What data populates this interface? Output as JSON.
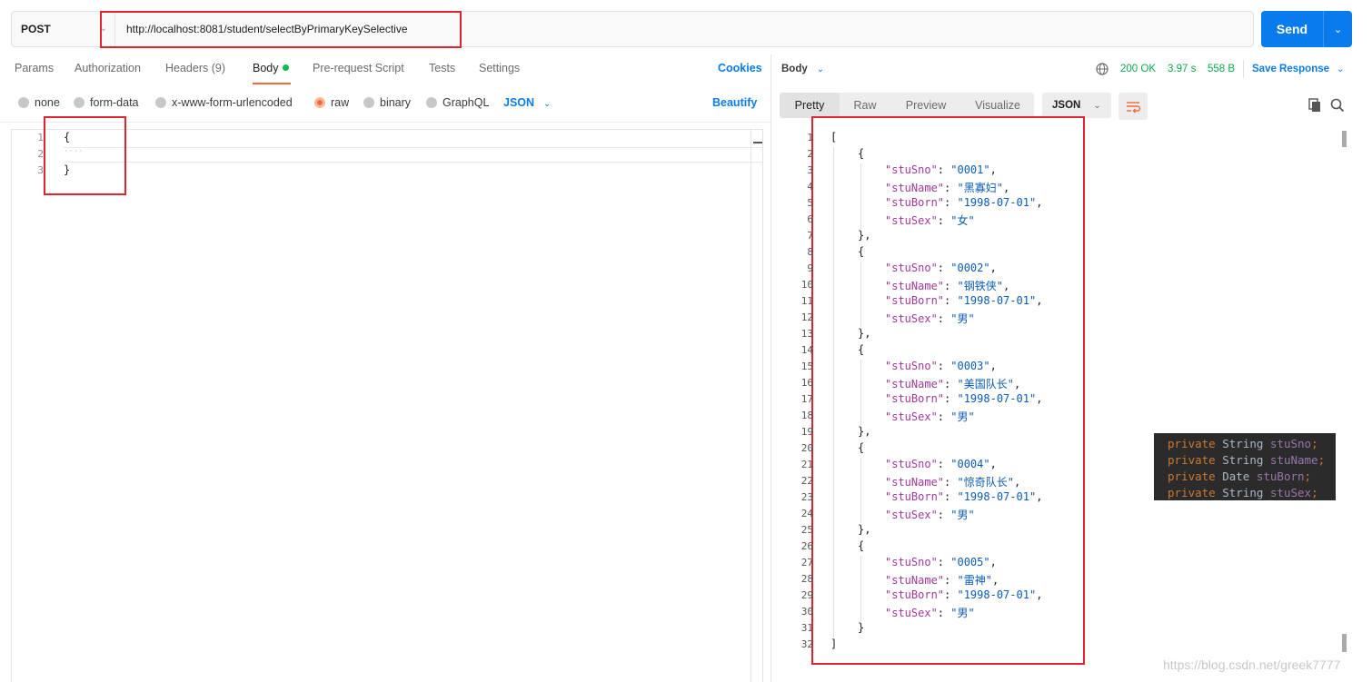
{
  "request": {
    "method": "POST",
    "url": "http://localhost:8081/student/selectByPrimaryKeySelective",
    "send_label": "Send"
  },
  "request_tabs": [
    "Params",
    "Authorization",
    "Headers (9)",
    "Body",
    "Pre-request Script",
    "Tests",
    "Settings"
  ],
  "cookies_label": "Cookies",
  "body_types": [
    "none",
    "form-data",
    "x-www-form-urlencoded",
    "raw",
    "binary",
    "GraphQL"
  ],
  "body_selected": "raw",
  "body_format": "JSON",
  "beautify_label": "Beautify",
  "request_editor": {
    "line_numbers": [
      "1",
      "2",
      "3"
    ],
    "lines": [
      "{",
      "····",
      "}"
    ]
  },
  "response": {
    "label": "Body",
    "status": "200 OK",
    "time": "3.97 s",
    "size": "558 B",
    "save_label": "Save Response",
    "view_tabs": [
      "Pretty",
      "Raw",
      "Preview",
      "Visualize"
    ],
    "active_view": "Pretty",
    "format": "JSON",
    "students": [
      {
        "stuSno": "0001",
        "stuName": "黑寡妇",
        "stuBorn": "1998-07-01",
        "stuSex": "女"
      },
      {
        "stuSno": "0002",
        "stuName": "钢铁侠",
        "stuBorn": "1998-07-01",
        "stuSex": "男"
      },
      {
        "stuSno": "0003",
        "stuName": "美国队长",
        "stuBorn": "1998-07-01",
        "stuSex": "男"
      },
      {
        "stuSno": "0004",
        "stuName": "惊奇队长",
        "stuBorn": "1998-07-01",
        "stuSex": "男"
      },
      {
        "stuSno": "0005",
        "stuName": "雷神",
        "stuBorn": "1998-07-01",
        "stuSex": "男"
      }
    ]
  },
  "code_snippet": [
    {
      "kw": "private",
      "type": "String",
      "field": "stuSno"
    },
    {
      "kw": "private",
      "type": "String",
      "field": "stuName"
    },
    {
      "kw": "private",
      "type": "Date",
      "field": "stuBorn"
    },
    {
      "kw": "private",
      "type": "String",
      "field": "stuSex"
    }
  ],
  "watermark": "https://blog.csdn.net/greek7777",
  "icons": {
    "method_chevron": "chevron-down-icon",
    "send_dropdown": "chevron-down-icon",
    "globe": "globe-icon",
    "wrap": "wrap-lines-icon",
    "copy": "copy-icon",
    "search": "search-icon"
  },
  "colors": {
    "accent": "#097bed",
    "active_tab": "#f26b3a",
    "status_ok": "#0ca94e",
    "annotation": "#e0232e"
  }
}
